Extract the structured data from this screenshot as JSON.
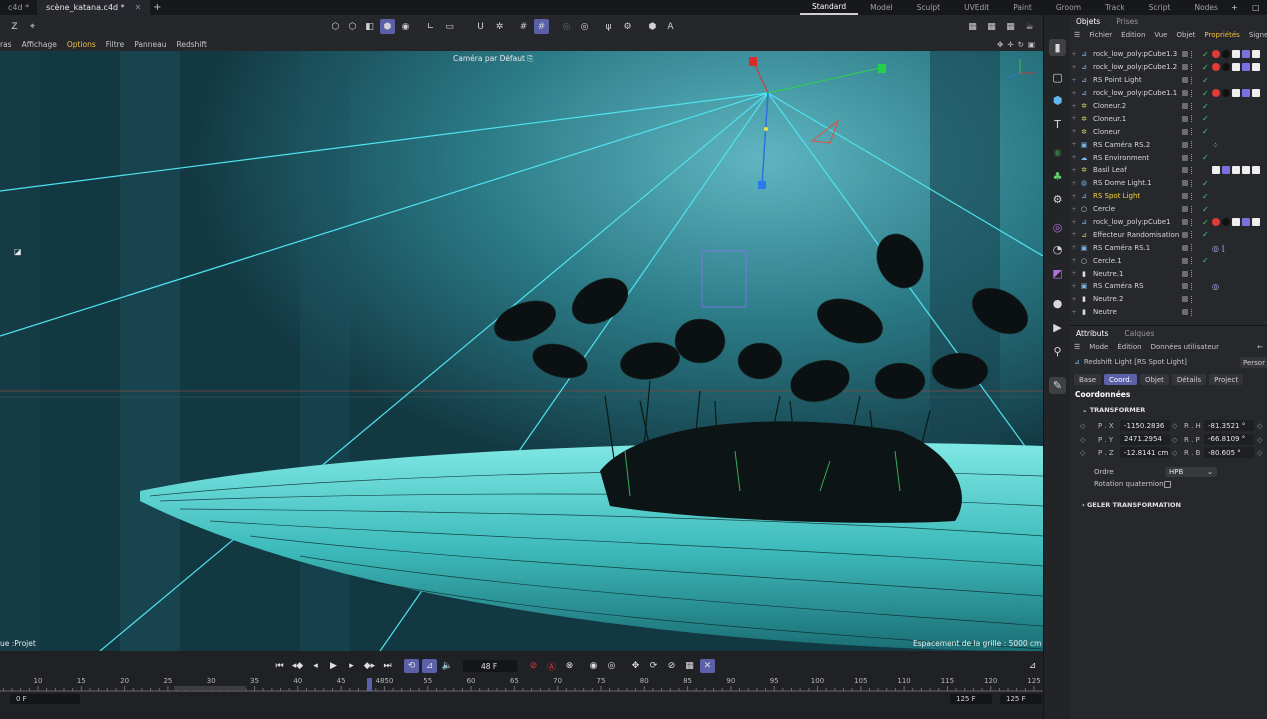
{
  "doc_tabs": [
    {
      "label": "c4d *",
      "active": false
    },
    {
      "label": "scène_katana.c4d *",
      "active": true
    }
  ],
  "layouts": [
    "Standard",
    "Model",
    "Sculpt",
    "UVEdit",
    "Paint",
    "Groom",
    "Track",
    "Script",
    "Nodes"
  ],
  "active_layout": "Standard",
  "viewport_menu": [
    "ras",
    "Affichage",
    "Options",
    "Filtre",
    "Panneau",
    "Redshift"
  ],
  "viewport": {
    "camera_label": "Caméra par Défaut",
    "project_label": "ue :Projet",
    "grid_label": "Espacement de la grille : 5000 cm"
  },
  "timeline": {
    "current_frame": "48 F",
    "ticks": [
      "10",
      "15",
      "20",
      "25",
      "30",
      "35",
      "40",
      "45",
      "4850",
      "55",
      "60",
      "65",
      "70",
      "75",
      "80",
      "85",
      "90",
      "95",
      "100",
      "105",
      "110",
      "115",
      "120",
      "125"
    ],
    "start_field": "0 F",
    "end_field_a": "125 F",
    "end_field_b": "125 F"
  },
  "objects_panel": {
    "tabs": [
      "Objets",
      "Prises"
    ],
    "menu": [
      "Fichier",
      "Édition",
      "Vue",
      "Objet",
      "Propriétés",
      "Signe"
    ],
    "rows": [
      {
        "name": "rock_low_poly:pCube1.3",
        "icon": "poly-icon",
        "check": true
      },
      {
        "name": "rock_low_poly:pCube1.2",
        "icon": "poly-icon",
        "check": true
      },
      {
        "name": "RS Point Light",
        "icon": "light-icon",
        "check": true
      },
      {
        "name": "rock_low_poly:pCube1.1",
        "icon": "poly-icon",
        "check": true
      },
      {
        "name": "Cloneur.2",
        "icon": "cloner-icon",
        "check": true
      },
      {
        "name": "Cloneur.1",
        "icon": "cloner-icon",
        "check": true
      },
      {
        "name": "Cloneur",
        "icon": "cloner-icon",
        "check": true
      },
      {
        "name": "RS Caméra RS.2",
        "icon": "camera-icon",
        "check": false
      },
      {
        "name": "RS Environment",
        "icon": "environment-icon",
        "check": true
      },
      {
        "name": "Basil Leaf",
        "icon": "cloner-icon",
        "check": false
      },
      {
        "name": "RS Dome Light.1",
        "icon": "dome-light-icon",
        "check": true
      },
      {
        "name": "RS Spot Light",
        "icon": "spot-light-icon",
        "check": true,
        "selected": true
      },
      {
        "name": "Cercle",
        "icon": "circle-icon",
        "check": true
      },
      {
        "name": "rock_low_poly:pCube1",
        "icon": "poly-icon",
        "check": true
      },
      {
        "name": "Effecteur Randomisation",
        "icon": "effector-icon",
        "check": true
      },
      {
        "name": "RS Caméra RS.1",
        "icon": "camera-icon",
        "check": false
      },
      {
        "name": "Cercle.1",
        "icon": "circle-icon",
        "check": true
      },
      {
        "name": "Neutre.1",
        "icon": "null-icon",
        "check": false
      },
      {
        "name": "RS Caméra RS",
        "icon": "camera-icon",
        "check": false
      },
      {
        "name": "Neutre.2",
        "icon": "null-icon",
        "check": false
      },
      {
        "name": "Neutre",
        "icon": "null-icon",
        "check": false
      }
    ]
  },
  "attributes_panel": {
    "tabs": [
      "Attributs",
      "Calques"
    ],
    "menu": [
      "Mode",
      "Édition",
      "Données utilisateur"
    ],
    "object_title": "Redshift Light [RS Spot Light]",
    "preset": "Persor",
    "sub_tabs": [
      "Base",
      "Coord.",
      "Objet",
      "Détails",
      "Project"
    ],
    "active_sub_tab": "Coord.",
    "section": "Coordonnées",
    "group": "TRANSFORMER",
    "coords": [
      {
        "pos_label": "P . X",
        "pos_value": "-1150.2836",
        "rot_label": "R . H",
        "rot_value": "-81.3521 °"
      },
      {
        "pos_label": "P . Y",
        "pos_value": "2471.2954",
        "rot_label": "R . P",
        "rot_value": "-66.8109 °"
      },
      {
        "pos_label": "P . Z",
        "pos_value": "-12.8141 cm",
        "rot_label": "R . B",
        "rot_value": "-80.605 °"
      }
    ],
    "ordre_label": "Ordre",
    "ordre_value": "HPB",
    "quaternion_label": "Rotation quaternion",
    "freeze_group": "GELER TRANSFORMATION"
  }
}
